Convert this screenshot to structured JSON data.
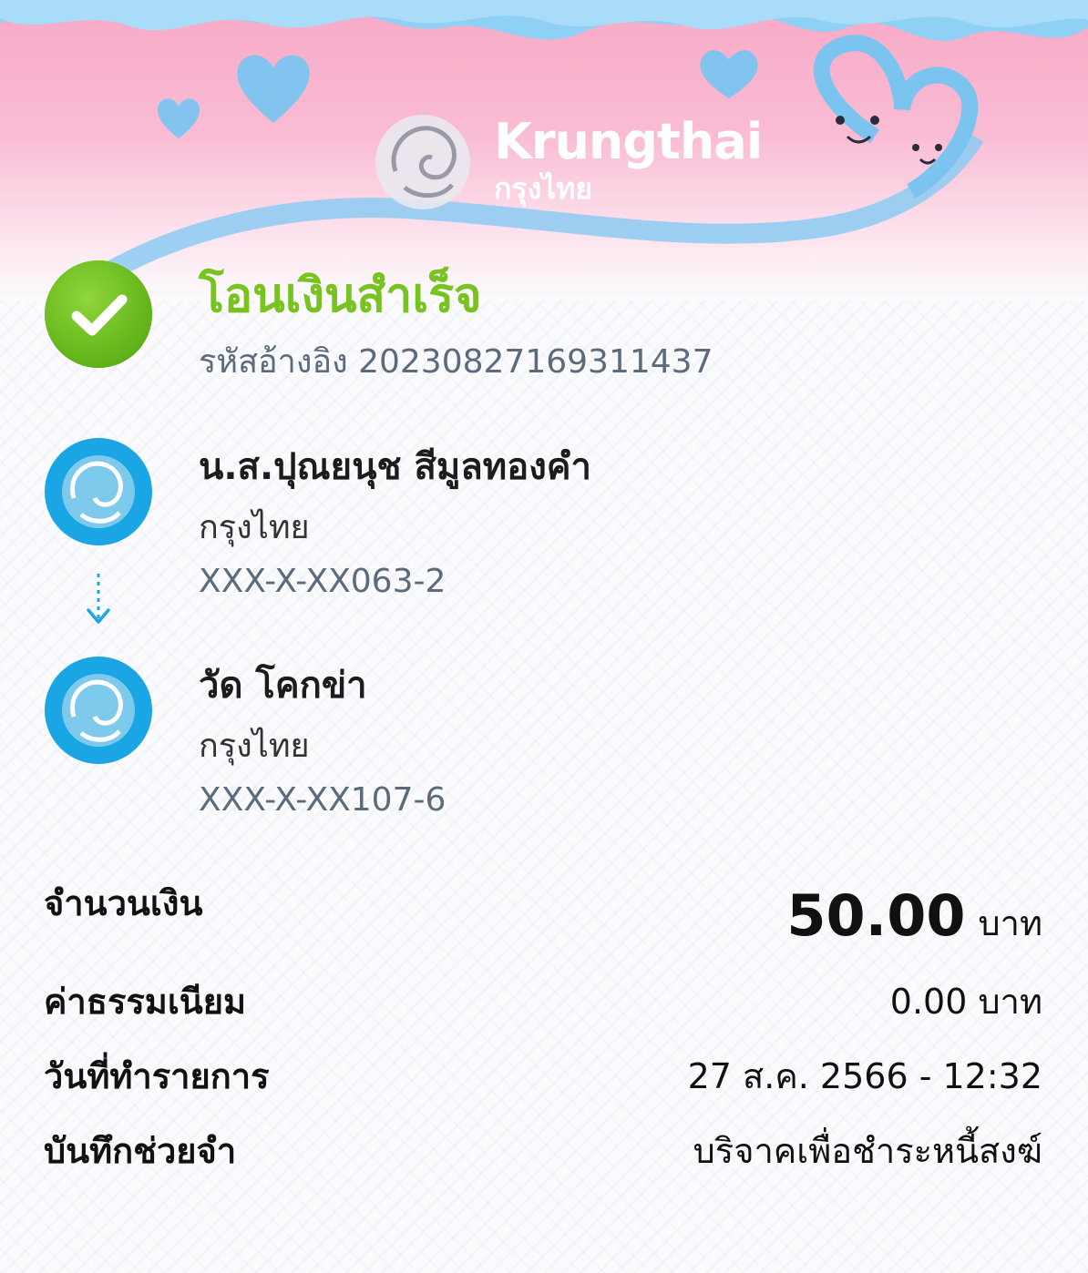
{
  "header": {
    "brand_en": "Krungthai",
    "brand_th": "กรุงไทย"
  },
  "status": {
    "title": "โอนเงินสำเร็จ",
    "reference": "รหัสอ้างอิง 20230827169311437",
    "icon": "check-icon",
    "color": "#78c31f"
  },
  "sender": {
    "name": "น.ส.ปุณยนุช สีมูลทองคำ",
    "bank": "กรุงไทย",
    "account": "XXX-X-XX063-2"
  },
  "receiver": {
    "name": "วัด โคกข่า",
    "bank": "กรุงไทย",
    "account": "XXX-X-XX107-6"
  },
  "details": {
    "amount_label": "จำนวนเงิน",
    "amount_value": "50.00",
    "amount_unit": "บาท",
    "fee_label": "ค่าธรรมเนียม",
    "fee_value": "0.00 บาท",
    "date_label": "วันที่ทำรายการ",
    "date_value": "27 ส.ค. 2566 - 12:32",
    "memo_label": "บันทึกช่วยจำ",
    "memo_value": "บริจาคเพื่อชำระหนี้สงฆ์"
  },
  "colors": {
    "bank_blue": "#1aa6e4",
    "banner_pink": "#f7a9c6",
    "ribbon_blue": "#7cc4f0"
  }
}
